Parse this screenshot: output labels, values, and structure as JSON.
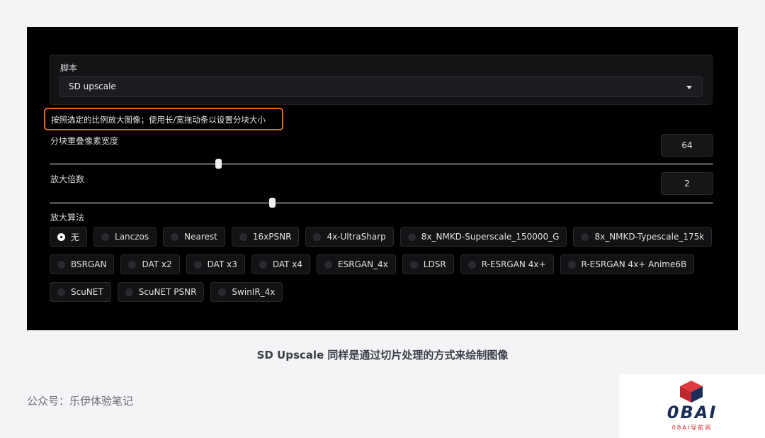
{
  "script_section": {
    "label": "脚本",
    "selected": "SD upscale"
  },
  "description": "按照选定的比例放大图像；使用长/宽拖动条以设置分块大小",
  "tile_overlap": {
    "label": "分块重叠像素宽度",
    "value": "64",
    "slider_fraction": 0.254
  },
  "scale_factor": {
    "label": "放大倍数",
    "value": "2",
    "slider_fraction": 0.335
  },
  "upscaler": {
    "label": "放大算法",
    "selected_index": 0,
    "rows": [
      [
        "无",
        "Lanczos",
        "Nearest",
        "16xPSNR",
        "4x-UltraSharp",
        "8x_NMKD-Superscale_150000_G",
        "8x_NMKD-Typescale_175k"
      ],
      [
        "BSRGAN",
        "DAT x2",
        "DAT x3",
        "DAT x4",
        "ESRGAN_4x",
        "LDSR",
        "R-ESRGAN 4x+",
        "R-ESRGAN 4x+ Anime6B"
      ],
      [
        "ScuNET",
        "ScuNET PSNR",
        "SwinIR_4x"
      ]
    ]
  },
  "caption": "SD Upscale 同样是通过切片处理的方式来绘制图像",
  "footer": "公众号：乐伊体验笔记",
  "watermark": {
    "title": "0BAI",
    "subtitle": "0BAI导航网"
  },
  "colors": {
    "highlight_border": "#e0682c",
    "panel_bg": "#000000",
    "page_bg": "#f4f4f6",
    "logo_navy": "#1b2e5a",
    "logo_red": "#d7262f"
  }
}
